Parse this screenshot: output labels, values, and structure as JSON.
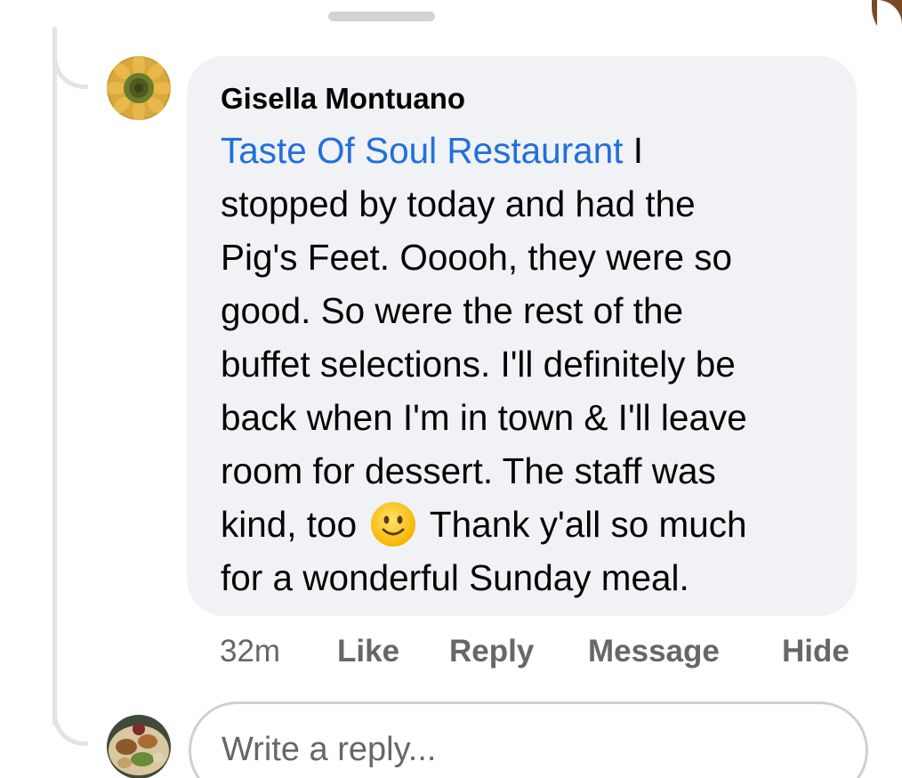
{
  "comment": {
    "author": "Gisella Montuano",
    "mention": "Taste Of Soul Restaurant",
    "lines": [
      " I",
      "stopped by today and had the",
      "Pig's Feet. Ooooh, they were so",
      "good. So were the rest of the",
      "buffet selections. I'll definitely be",
      "back when I'm in town & I'll leave",
      "room for dessert. The staff was"
    ],
    "line_before_emoji": "kind, too",
    "emoji": "slightly-smiling-face",
    "line_after_emoji": "Thank y'all so much",
    "last_line": "for a wonderful Sunday meal."
  },
  "actions": {
    "time": "32m",
    "like": "Like",
    "reply": "Reply",
    "message": "Message",
    "hide": "Hide"
  },
  "reply_box": {
    "placeholder": "Write a reply..."
  },
  "colors": {
    "bubble": "#f0f2f5",
    "mention": "#216fdb",
    "text": "#050505",
    "secondary": "#65676b"
  }
}
